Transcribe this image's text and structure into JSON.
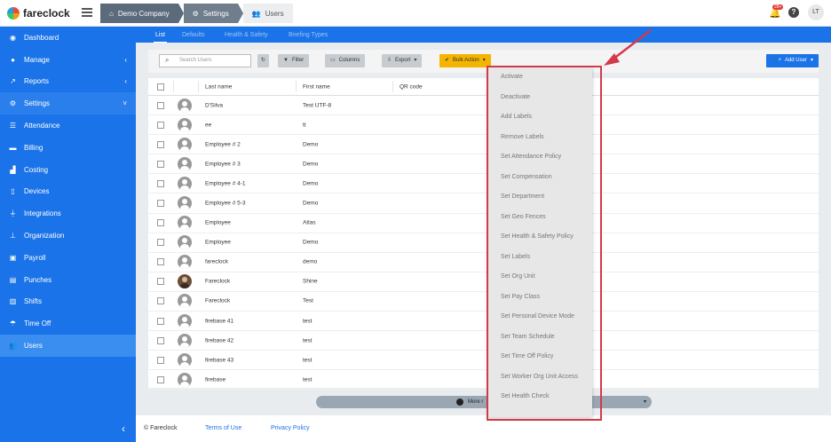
{
  "app": {
    "name": "fareclock"
  },
  "breadcrumbs": [
    "Demo Company",
    "Settings",
    "Users"
  ],
  "notifications": {
    "count": "28+"
  },
  "user": {
    "initials": "LT"
  },
  "sidebar": {
    "items": [
      {
        "label": "Dashboard",
        "icon": "dashboard-icon"
      },
      {
        "label": "Manage",
        "icon": "person-icon"
      },
      {
        "label": "Reports",
        "icon": "chart-icon"
      },
      {
        "label": "Settings",
        "icon": "gear-icon"
      },
      {
        "label": "Attendance",
        "icon": "list-icon"
      },
      {
        "label": "Billing",
        "icon": "card-icon"
      },
      {
        "label": "Costing",
        "icon": "factory-icon"
      },
      {
        "label": "Devices",
        "icon": "tablet-icon"
      },
      {
        "label": "Integrations",
        "icon": "plug-icon"
      },
      {
        "label": "Organization",
        "icon": "org-icon"
      },
      {
        "label": "Payroll",
        "icon": "money-icon"
      },
      {
        "label": "Punches",
        "icon": "punch-icon"
      },
      {
        "label": "Shifts",
        "icon": "shifts-icon"
      },
      {
        "label": "Time Off",
        "icon": "umbrella-icon"
      },
      {
        "label": "Users",
        "icon": "users-icon"
      }
    ]
  },
  "tabs": [
    "List",
    "Defaults",
    "Health & Safety",
    "Briefing Types"
  ],
  "toolbar": {
    "search_placeholder": "Search Users",
    "filter": "Filter",
    "columns": "Columns",
    "export": "Export",
    "bulk_action": "Bulk Action",
    "add_user": "Add User"
  },
  "table": {
    "headers": [
      "Last name",
      "First name",
      "QR code"
    ],
    "rows": [
      {
        "last": "D'Silva",
        "first": "Test UTF-8"
      },
      {
        "last": "ee",
        "first": "tt"
      },
      {
        "last": "Employee # 2",
        "first": "Demo"
      },
      {
        "last": "Employee # 3",
        "first": "Demo"
      },
      {
        "last": "Employee # 4-1",
        "first": "Demo"
      },
      {
        "last": "Employee # 5-3",
        "first": "Demo"
      },
      {
        "last": "Employee",
        "first": "Atlas"
      },
      {
        "last": "Employee",
        "first": "Demo"
      },
      {
        "last": "fareclock",
        "first": "demo"
      },
      {
        "last": "Fareclock",
        "first": "Shine"
      },
      {
        "last": "Fareclock",
        "first": "Test"
      },
      {
        "last": "firebase 41",
        "first": "test"
      },
      {
        "last": "firebase 42",
        "first": "test"
      },
      {
        "last": "firebase 43",
        "first": "test"
      },
      {
        "last": "firebase",
        "first": "test"
      }
    ]
  },
  "more_button": "More r",
  "bulk_menu": [
    "Activate",
    "Deactivate",
    "Add Labels",
    "Remove Labels",
    "Set Attendance Policy",
    "Set Compensation",
    "Set Department",
    "Set Geo Fences",
    "Set Health & Safety Policy",
    "Set Labels",
    "Set Org Unit",
    "Set Pay Class",
    "Set Personal Device Mode",
    "Set Team Schedule",
    "Set Time Off Policy",
    "Set Worker Org Unit Access",
    "Set Health Check"
  ],
  "footer": {
    "copyright": "© Fareclock",
    "terms": "Terms of Use",
    "privacy": "Privacy Policy"
  },
  "colors": {
    "primary": "#1a73e8",
    "accent": "#f4b400",
    "highlight": "#d23a4a"
  }
}
